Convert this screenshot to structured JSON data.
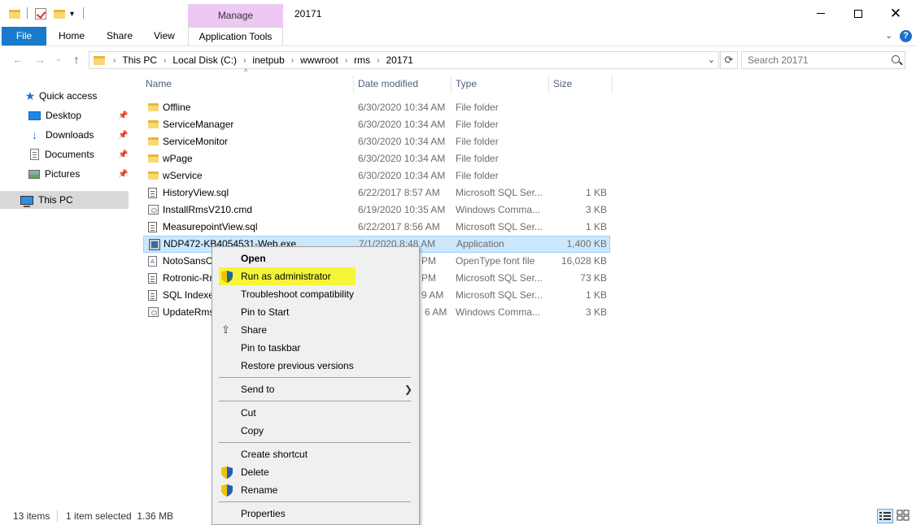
{
  "titlebar": {
    "manage_label": "Manage",
    "window_title": "20171",
    "close_glyph": "✕"
  },
  "ribbon": {
    "tabs": [
      "File",
      "Home",
      "Share",
      "View",
      "Application Tools"
    ],
    "help_label": "?"
  },
  "address": {
    "crumbs": [
      "This PC",
      "Local Disk (C:)",
      "inetpub",
      "wwwroot",
      "rms",
      "20171"
    ],
    "search_placeholder": "Search 20171"
  },
  "navpane": {
    "items": [
      {
        "label": "Quick access",
        "icon": "star-icon"
      },
      {
        "label": "Desktop",
        "icon": "desktop-icon",
        "pinned": true
      },
      {
        "label": "Downloads",
        "icon": "download-icon",
        "pinned": true
      },
      {
        "label": "Documents",
        "icon": "documents-icon",
        "pinned": true
      },
      {
        "label": "Pictures",
        "icon": "pictures-icon",
        "pinned": true
      },
      {
        "label": "This PC",
        "icon": "computer-icon",
        "selected": true
      }
    ]
  },
  "filelist": {
    "columns": [
      "Name",
      "Date modified",
      "Type",
      "Size"
    ],
    "rows": [
      {
        "name": "Offline",
        "date": "6/30/2020 10:34 AM",
        "type": "File folder",
        "size": "",
        "icon": "folder-icon"
      },
      {
        "name": "ServiceManager",
        "date": "6/30/2020 10:34 AM",
        "type": "File folder",
        "size": "",
        "icon": "folder-icon"
      },
      {
        "name": "ServiceMonitor",
        "date": "6/30/2020 10:34 AM",
        "type": "File folder",
        "size": "",
        "icon": "folder-icon"
      },
      {
        "name": "wPage",
        "date": "6/30/2020 10:34 AM",
        "type": "File folder",
        "size": "",
        "icon": "folder-icon"
      },
      {
        "name": "wService",
        "date": "6/30/2020 10:34 AM",
        "type": "File folder",
        "size": "",
        "icon": "folder-icon"
      },
      {
        "name": "HistoryView.sql",
        "date": "6/22/2017 8:57 AM",
        "type": "Microsoft SQL Ser...",
        "size": "1 KB",
        "icon": "sql-file-icon"
      },
      {
        "name": "InstallRmsV210.cmd",
        "date": "6/19/2020 10:35 AM",
        "type": "Windows Comma...",
        "size": "3 KB",
        "icon": "cmd-file-icon"
      },
      {
        "name": "MeasurepointView.sql",
        "date": "6/22/2017 8:56 AM",
        "type": "Microsoft SQL Ser...",
        "size": "1 KB",
        "icon": "sql-file-icon"
      },
      {
        "name": "NDP472-KB4054531-Web.exe",
        "date": "7/1/2020 8:48 AM",
        "type": "Application",
        "size": "1,400 KB",
        "icon": "exe-file-icon",
        "selected": true
      },
      {
        "name": "NotoSansC",
        "date": "PM",
        "type": "OpenType font file",
        "size": "16,028 KB",
        "icon": "font-file-icon"
      },
      {
        "name": "Rotronic-Rr",
        "date": "PM",
        "type": "Microsoft SQL Ser...",
        "size": "73 KB",
        "icon": "sql-file-icon"
      },
      {
        "name": "SQL Indexes",
        "date": "9 AM",
        "type": "Microsoft SQL Ser...",
        "size": "1 KB",
        "icon": "sql-file-icon"
      },
      {
        "name": "UpdateRms",
        "date": "6 AM",
        "type": "Windows Comma...",
        "size": "3 KB",
        "icon": "cmd-file-icon"
      }
    ]
  },
  "context_menu": {
    "open": "Open",
    "run_as_admin": "Run as administrator",
    "troubleshoot": "Troubleshoot compatibility",
    "pin_start": "Pin to Start",
    "share": "Share",
    "pin_taskbar": "Pin to taskbar",
    "restore": "Restore previous versions",
    "send_to": "Send to",
    "cut": "Cut",
    "copy": "Copy",
    "create_shortcut": "Create shortcut",
    "delete": "Delete",
    "rename": "Rename",
    "properties": "Properties",
    "highlight_color": "#f5f53a"
  },
  "statusbar": {
    "item_count": "13 items",
    "selection": "1 item selected  1.36 MB"
  },
  "colors": {
    "file_tab": "#1979ca",
    "manage_tab": "#ecc8f3",
    "selection": "#cce8ff"
  }
}
